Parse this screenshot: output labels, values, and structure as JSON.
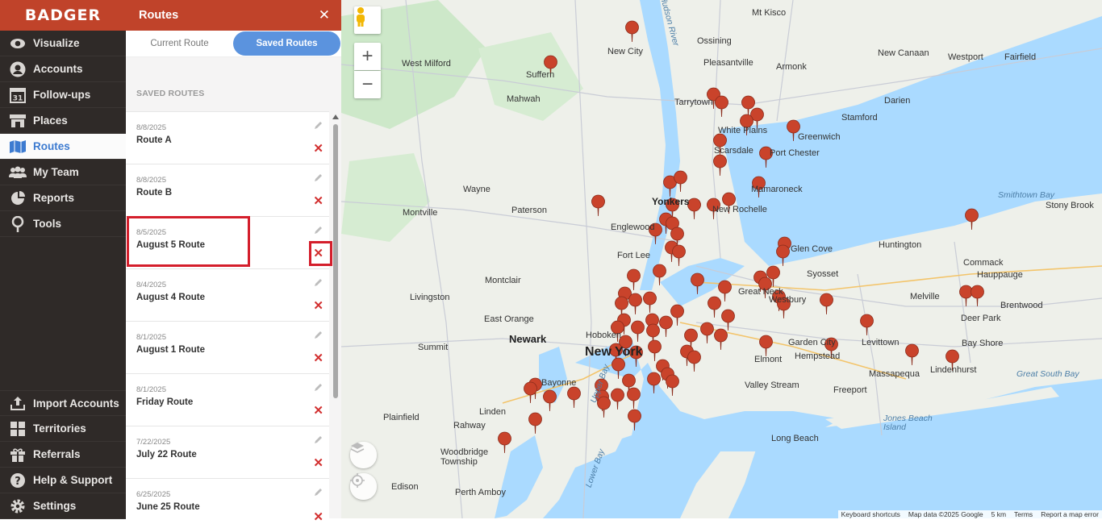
{
  "app": {
    "logo": "BADGER"
  },
  "nav": {
    "items": [
      {
        "label": "Visualize",
        "icon": "eye-icon"
      },
      {
        "label": "Accounts",
        "icon": "user-circle-icon"
      },
      {
        "label": "Follow-ups",
        "icon": "calendar-icon"
      },
      {
        "label": "Places",
        "icon": "storefront-icon"
      },
      {
        "label": "Routes",
        "icon": "map-icon",
        "active": true
      },
      {
        "label": "My Team",
        "icon": "team-icon"
      },
      {
        "label": "Reports",
        "icon": "chart-icon"
      },
      {
        "label": "Tools",
        "icon": "wrench-icon"
      }
    ],
    "bottom_items": [
      {
        "label": "Import Accounts",
        "icon": "upload-icon"
      },
      {
        "label": "Territories",
        "icon": "grid-icon"
      },
      {
        "label": "Referrals",
        "icon": "gift-icon"
      },
      {
        "label": "Help & Support",
        "icon": "help-icon"
      },
      {
        "label": "Settings",
        "icon": "gear-icon"
      }
    ],
    "calendar_day": "31"
  },
  "panel": {
    "title": "Routes",
    "tabs": {
      "current": "Current Route",
      "saved": "Saved Routes"
    },
    "section_label": "SAVED ROUTES",
    "routes": [
      {
        "date": "8/8/2025",
        "name": "Route A"
      },
      {
        "date": "8/8/2025",
        "name": "Route B"
      },
      {
        "date": "8/5/2025",
        "name": "August 5 Route"
      },
      {
        "date": "8/4/2025",
        "name": "August 4 Route"
      },
      {
        "date": "8/1/2025",
        "name": "August 1 Route"
      },
      {
        "date": "8/1/2025",
        "name": "Friday Route"
      },
      {
        "date": "7/22/2025",
        "name": "July 22 Route"
      },
      {
        "date": "6/25/2025",
        "name": "June 25 Route"
      }
    ]
  },
  "map": {
    "labels": {
      "new_city": "New City",
      "west_milford": "West Milford",
      "suffern": "Suffern",
      "mahwah": "Mahwah",
      "ossining": "Ossining",
      "pleasantville": "Pleasantville",
      "armonk": "Armonk",
      "mt_kisco": "Mt Kisco",
      "new_canaan": "New Canaan",
      "westport": "Westport",
      "fairfield": "Fairfield",
      "darien": "Darien",
      "tarrytown": "Tarrytown",
      "white_plains": "White Plains",
      "stamford": "Stamford",
      "greenwich": "Greenwich",
      "port_chester": "Port Chester",
      "scarsdale": "Scarsdale",
      "wayne": "Wayne",
      "montville": "Montville",
      "paterson": "Paterson",
      "yonkers": "Yonkers",
      "mamaroneck": "Mamaroneck",
      "new_rochelle": "New Rochelle",
      "englewood": "Englewood",
      "fort_lee": "Fort Lee",
      "montclair": "Montclair",
      "livingston": "Livingston",
      "east_orange": "East Orange",
      "newark": "Newark",
      "summit": "Summit",
      "hoboken": "Hoboken",
      "new_york": "New York",
      "bayonne": "Bayonne",
      "plainfield": "Plainfield",
      "linden": "Linden",
      "rahway": "Rahway",
      "woodbridge": "Woodbridge Township",
      "perth_amboy": "Perth Amboy",
      "edison": "Edison",
      "glen_cove": "Glen Cove",
      "huntington": "Huntington",
      "commack": "Commack",
      "syosset": "Syosset",
      "hauppauge": "Hauppauge",
      "smithtown_bay": "Smithtown Bay",
      "stony_brook": "Stony Brook",
      "melville": "Melville",
      "deer_park": "Deer Park",
      "brentwood": "Brentwood",
      "garden_city": "Garden City",
      "levittown": "Levittown",
      "bay_shore": "Bay Shore",
      "hempstead": "Hempstead",
      "elmont": "Elmont",
      "valley_stream": "Valley Stream",
      "freeport": "Freeport",
      "massapequa": "Massapequa",
      "lindenhurst": "Lindenhurst",
      "great_south_bay": "Great South Bay",
      "jones_beach": "Jones Beach Island",
      "long_beach": "Long Beach",
      "lower_bay": "Lower Bay",
      "upper_bay": "Upper Bay",
      "hudson_river": "Hudson River",
      "great_neck": "Great Neck",
      "westbury": "Westbury"
    },
    "footer": {
      "shortcuts": "Keyboard shortcuts",
      "data": "Map data ©2025 Google",
      "scale": "5 km",
      "terms": "Terms",
      "report": "Report a map error"
    },
    "colors": {
      "pin": "#c9432b",
      "water": "#aadaff",
      "land": "#eef0ea",
      "park": "#cde8c9"
    }
  }
}
